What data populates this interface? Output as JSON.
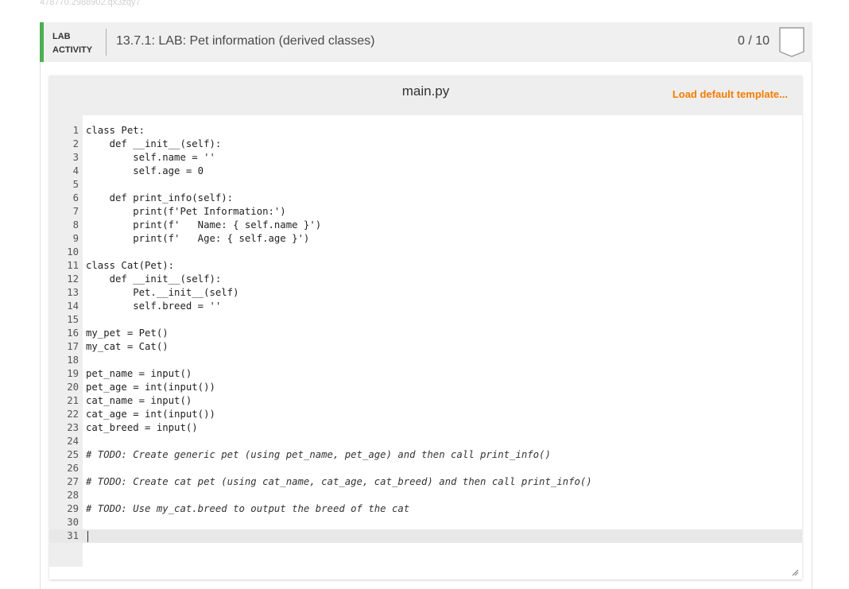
{
  "session_id": "478770.2988902.qx3zqy7",
  "header": {
    "label_line1": "LAB",
    "label_line2": "ACTIVITY",
    "title": "13.7.1: LAB: Pet information (derived classes)",
    "score": "0 / 10",
    "accent_color": "#4caf50"
  },
  "editor": {
    "file_name": "main.py",
    "load_template_label": "Load default template...",
    "load_template_color": "#f57c00",
    "active_line": 31,
    "lines": [
      {
        "n": "1",
        "code": "class Pet:"
      },
      {
        "n": "2",
        "code": "    def __init__(self):"
      },
      {
        "n": "3",
        "code": "        self.name = ''"
      },
      {
        "n": "4",
        "code": "        self.age = 0"
      },
      {
        "n": "5",
        "code": ""
      },
      {
        "n": "6",
        "code": "    def print_info(self):"
      },
      {
        "n": "7",
        "code": "        print(f'Pet Information:')"
      },
      {
        "n": "8",
        "code": "        print(f'   Name: { self.name }')"
      },
      {
        "n": "9",
        "code": "        print(f'   Age: { self.age }')"
      },
      {
        "n": "10",
        "code": ""
      },
      {
        "n": "11",
        "code": "class Cat(Pet):"
      },
      {
        "n": "12",
        "code": "    def __init__(self):"
      },
      {
        "n": "13",
        "code": "        Pet.__init__(self)"
      },
      {
        "n": "14",
        "code": "        self.breed = ''"
      },
      {
        "n": "15",
        "code": ""
      },
      {
        "n": "16",
        "code": "my_pet = Pet()"
      },
      {
        "n": "17",
        "code": "my_cat = Cat()"
      },
      {
        "n": "18",
        "code": ""
      },
      {
        "n": "19",
        "code": "pet_name = input()"
      },
      {
        "n": "20",
        "code": "pet_age = int(input())"
      },
      {
        "n": "21",
        "code": "cat_name = input()"
      },
      {
        "n": "22",
        "code": "cat_age = int(input())"
      },
      {
        "n": "23",
        "code": "cat_breed = input()"
      },
      {
        "n": "24",
        "code": ""
      },
      {
        "n": "25",
        "code": "# TODO: Create generic pet (using pet_name, pet_age) and then call print_info()"
      },
      {
        "n": "26",
        "code": ""
      },
      {
        "n": "27",
        "code": "# TODO: Create cat pet (using cat_name, cat_age, cat_breed) and then call print_info()"
      },
      {
        "n": "28",
        "code": ""
      },
      {
        "n": "29",
        "code": "# TODO: Use my_cat.breed to output the breed of the cat"
      },
      {
        "n": "30",
        "code": ""
      },
      {
        "n": "31",
        "code": ""
      }
    ]
  }
}
